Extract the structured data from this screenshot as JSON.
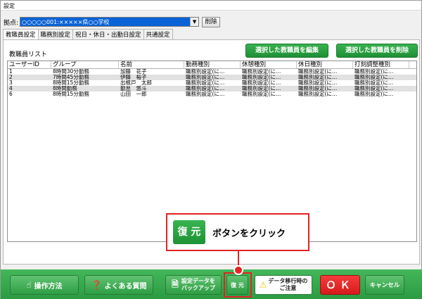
{
  "window": {
    "title": "設定"
  },
  "site": {
    "label": "拠点:",
    "selected": "○○○○○001:×××××県○○学校",
    "delete_label": "削除"
  },
  "tabs": [
    {
      "label": "教職員設定"
    },
    {
      "label": "職務別設定"
    },
    {
      "label": "祝日・休日・出勤日設定"
    },
    {
      "label": "共通設定"
    }
  ],
  "staff_list": {
    "title": "教職員リスト",
    "edit_button": "選択した教職員を編集",
    "delete_button": "選択した教職員を削除",
    "columns": [
      "ユーザーID",
      "グループ",
      "名前",
      "勤務種別",
      "休憩種別",
      "休日種別",
      "打刻調整種別"
    ],
    "rows": [
      [
        "1",
        "8時間30分勤務",
        "加藤　花子",
        "職務別設定(に…",
        "職務別設定(に…",
        "職務別設定(に…",
        "職務別設定(に…"
      ],
      [
        "2",
        "7時間45分勤務",
        "伊藤　裕子",
        "職務別設定(に…",
        "職務別設定(に…",
        "職務別設定(に…",
        "職務別設定(に…"
      ],
      [
        "3",
        "8時間15分勤務",
        "出根戸　太郎",
        "職務別設定(に…",
        "職務別設定(に…",
        "職務別設定(に…",
        "職務別設定(に…"
      ],
      [
        "4",
        "8時間勤務",
        "勤怠　悠斗",
        "職務別設定(に…",
        "職務別設定(に…",
        "職務別設定(に…",
        "職務別設定(に…"
      ],
      [
        "6",
        "8時間15分勤務",
        "山田　一郎",
        "職務別設定(に…",
        "職務別設定(に…",
        "職務別設定(に…",
        "職務別設定(に…"
      ]
    ]
  },
  "callout": {
    "badge": "復 元",
    "text": "ボタンをクリック"
  },
  "bottom": {
    "operations": "操作方法",
    "faq": "よくある質問",
    "backup_line1": "設定データを",
    "backup_line2": "バックアップ",
    "restore": "復 元",
    "notice_line1": "データ移行時の",
    "notice_line2": "ご注意",
    "ok": "ＯＫ",
    "cancel": "キャンセル"
  },
  "icons": {
    "hand": "hand-pointer-icon",
    "faq": "faq-icon",
    "backup": "backup-icon",
    "warning": "warning-icon",
    "dropdown": "chevron-down-icon"
  },
  "colors": {
    "accent_green": "#2b9a41",
    "callout_red": "#e52222",
    "ok_red": "#d51b1b",
    "selection_blue": "#0a63d6",
    "alt_row": "#e1e1e1"
  }
}
